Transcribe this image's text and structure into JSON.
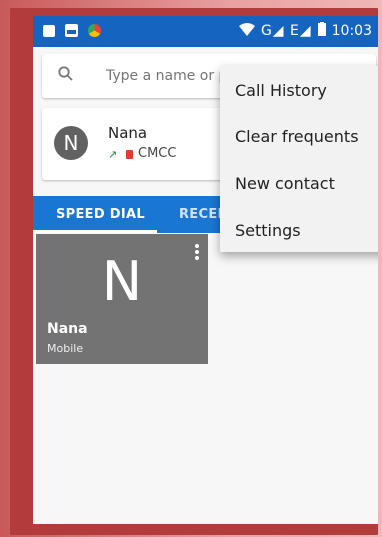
{
  "status_bar": {
    "signal_text": "G◢ E◢",
    "time": "10:03",
    "icons": [
      "sim-card-icon",
      "gallery-icon",
      "chrome-icon",
      "wifi-icon",
      "battery-icon"
    ]
  },
  "search": {
    "placeholder": "Type a name or phone number",
    "value": ""
  },
  "contact_card": {
    "avatar_initial": "N",
    "name": "Nana",
    "call_indicator": "↗",
    "carrier": "CMCC"
  },
  "tabs": [
    {
      "label": "SPEED DIAL",
      "active": true
    },
    {
      "label": "RECENTS",
      "active": false
    }
  ],
  "speed_dial_tile": {
    "letter": "N",
    "name": "Nana",
    "type": "Mobile"
  },
  "overflow_menu": {
    "items": [
      "Call History",
      "Clear frequents",
      "New contact",
      "Settings"
    ]
  },
  "colors": {
    "status_bar": "#1565c0",
    "tabs": "#1976d2",
    "tile": "#737373",
    "avatar": "#616161"
  }
}
